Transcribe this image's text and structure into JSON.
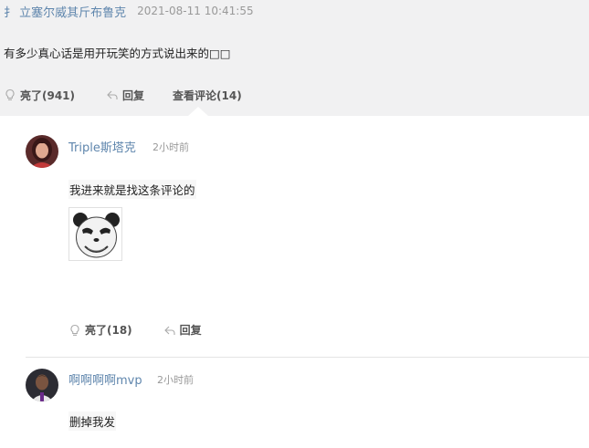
{
  "post": {
    "author": "扌 立塞尔威其斤布鲁克",
    "time": "2021-08-11 10:41:55",
    "text": "有多少真心话是用开玩笑的方式说出来的□□",
    "like_label": "亮了(941)",
    "reply_label": "回复",
    "comments_label": "查看评论(14)"
  },
  "comments": [
    {
      "name": "Triple斯塔克",
      "time": "2小时前",
      "text": "我进来就是找这条评论的",
      "like_label": "亮了(18)",
      "reply_label": "回复"
    },
    {
      "name": "啊啊啊啊mvp",
      "time": "2小时前",
      "text": "删掉我发"
    }
  ],
  "icons": {
    "like": "lightbulb-icon",
    "reply": "reply-arrow-icon",
    "avatar_1": "avatar-woman-photo",
    "avatar_2": "avatar-player-photo",
    "sticker": "panda-meme-sticker"
  },
  "colors": {
    "link_blue": "#5f86ad",
    "post_bg": "#f1f1f2",
    "muted": "#999999"
  }
}
